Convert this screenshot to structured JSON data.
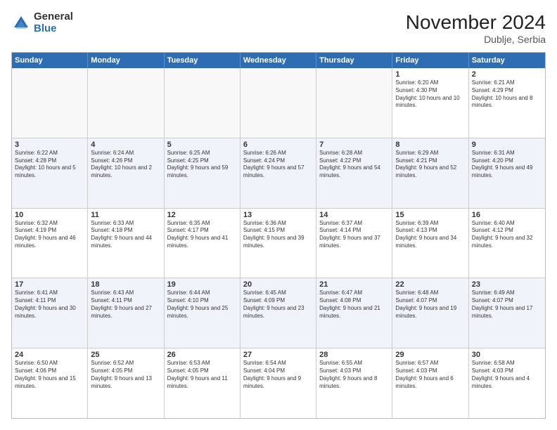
{
  "header": {
    "logo_general": "General",
    "logo_blue": "Blue",
    "month_title": "November 2024",
    "location": "Dublje, Serbia"
  },
  "weekdays": [
    "Sunday",
    "Monday",
    "Tuesday",
    "Wednesday",
    "Thursday",
    "Friday",
    "Saturday"
  ],
  "rows": [
    [
      {
        "day": "",
        "info": "",
        "empty": true
      },
      {
        "day": "",
        "info": "",
        "empty": true
      },
      {
        "day": "",
        "info": "",
        "empty": true
      },
      {
        "day": "",
        "info": "",
        "empty": true
      },
      {
        "day": "",
        "info": "",
        "empty": true
      },
      {
        "day": "1",
        "info": "Sunrise: 6:20 AM\nSunset: 4:30 PM\nDaylight: 10 hours and 10 minutes.",
        "empty": false
      },
      {
        "day": "2",
        "info": "Sunrise: 6:21 AM\nSunset: 4:29 PM\nDaylight: 10 hours and 8 minutes.",
        "empty": false
      }
    ],
    [
      {
        "day": "3",
        "info": "Sunrise: 6:22 AM\nSunset: 4:28 PM\nDaylight: 10 hours and 5 minutes.",
        "empty": false
      },
      {
        "day": "4",
        "info": "Sunrise: 6:24 AM\nSunset: 4:26 PM\nDaylight: 10 hours and 2 minutes.",
        "empty": false
      },
      {
        "day": "5",
        "info": "Sunrise: 6:25 AM\nSunset: 4:25 PM\nDaylight: 9 hours and 59 minutes.",
        "empty": false
      },
      {
        "day": "6",
        "info": "Sunrise: 6:26 AM\nSunset: 4:24 PM\nDaylight: 9 hours and 57 minutes.",
        "empty": false
      },
      {
        "day": "7",
        "info": "Sunrise: 6:28 AM\nSunset: 4:22 PM\nDaylight: 9 hours and 54 minutes.",
        "empty": false
      },
      {
        "day": "8",
        "info": "Sunrise: 6:29 AM\nSunset: 4:21 PM\nDaylight: 9 hours and 52 minutes.",
        "empty": false
      },
      {
        "day": "9",
        "info": "Sunrise: 6:31 AM\nSunset: 4:20 PM\nDaylight: 9 hours and 49 minutes.",
        "empty": false
      }
    ],
    [
      {
        "day": "10",
        "info": "Sunrise: 6:32 AM\nSunset: 4:19 PM\nDaylight: 9 hours and 46 minutes.",
        "empty": false
      },
      {
        "day": "11",
        "info": "Sunrise: 6:33 AM\nSunset: 4:18 PM\nDaylight: 9 hours and 44 minutes.",
        "empty": false
      },
      {
        "day": "12",
        "info": "Sunrise: 6:35 AM\nSunset: 4:17 PM\nDaylight: 9 hours and 41 minutes.",
        "empty": false
      },
      {
        "day": "13",
        "info": "Sunrise: 6:36 AM\nSunset: 4:15 PM\nDaylight: 9 hours and 39 minutes.",
        "empty": false
      },
      {
        "day": "14",
        "info": "Sunrise: 6:37 AM\nSunset: 4:14 PM\nDaylight: 9 hours and 37 minutes.",
        "empty": false
      },
      {
        "day": "15",
        "info": "Sunrise: 6:39 AM\nSunset: 4:13 PM\nDaylight: 9 hours and 34 minutes.",
        "empty": false
      },
      {
        "day": "16",
        "info": "Sunrise: 6:40 AM\nSunset: 4:12 PM\nDaylight: 9 hours and 32 minutes.",
        "empty": false
      }
    ],
    [
      {
        "day": "17",
        "info": "Sunrise: 6:41 AM\nSunset: 4:11 PM\nDaylight: 9 hours and 30 minutes.",
        "empty": false
      },
      {
        "day": "18",
        "info": "Sunrise: 6:43 AM\nSunset: 4:11 PM\nDaylight: 9 hours and 27 minutes.",
        "empty": false
      },
      {
        "day": "19",
        "info": "Sunrise: 6:44 AM\nSunset: 4:10 PM\nDaylight: 9 hours and 25 minutes.",
        "empty": false
      },
      {
        "day": "20",
        "info": "Sunrise: 6:45 AM\nSunset: 4:09 PM\nDaylight: 9 hours and 23 minutes.",
        "empty": false
      },
      {
        "day": "21",
        "info": "Sunrise: 6:47 AM\nSunset: 4:08 PM\nDaylight: 9 hours and 21 minutes.",
        "empty": false
      },
      {
        "day": "22",
        "info": "Sunrise: 6:48 AM\nSunset: 4:07 PM\nDaylight: 9 hours and 19 minutes.",
        "empty": false
      },
      {
        "day": "23",
        "info": "Sunrise: 6:49 AM\nSunset: 4:07 PM\nDaylight: 9 hours and 17 minutes.",
        "empty": false
      }
    ],
    [
      {
        "day": "24",
        "info": "Sunrise: 6:50 AM\nSunset: 4:06 PM\nDaylight: 9 hours and 15 minutes.",
        "empty": false
      },
      {
        "day": "25",
        "info": "Sunrise: 6:52 AM\nSunset: 4:05 PM\nDaylight: 9 hours and 13 minutes.",
        "empty": false
      },
      {
        "day": "26",
        "info": "Sunrise: 6:53 AM\nSunset: 4:05 PM\nDaylight: 9 hours and 11 minutes.",
        "empty": false
      },
      {
        "day": "27",
        "info": "Sunrise: 6:54 AM\nSunset: 4:04 PM\nDaylight: 9 hours and 9 minutes.",
        "empty": false
      },
      {
        "day": "28",
        "info": "Sunrise: 6:55 AM\nSunset: 4:03 PM\nDaylight: 9 hours and 8 minutes.",
        "empty": false
      },
      {
        "day": "29",
        "info": "Sunrise: 6:57 AM\nSunset: 4:03 PM\nDaylight: 9 hours and 6 minutes.",
        "empty": false
      },
      {
        "day": "30",
        "info": "Sunrise: 6:58 AM\nSunset: 4:03 PM\nDaylight: 9 hours and 4 minutes.",
        "empty": false
      }
    ]
  ]
}
